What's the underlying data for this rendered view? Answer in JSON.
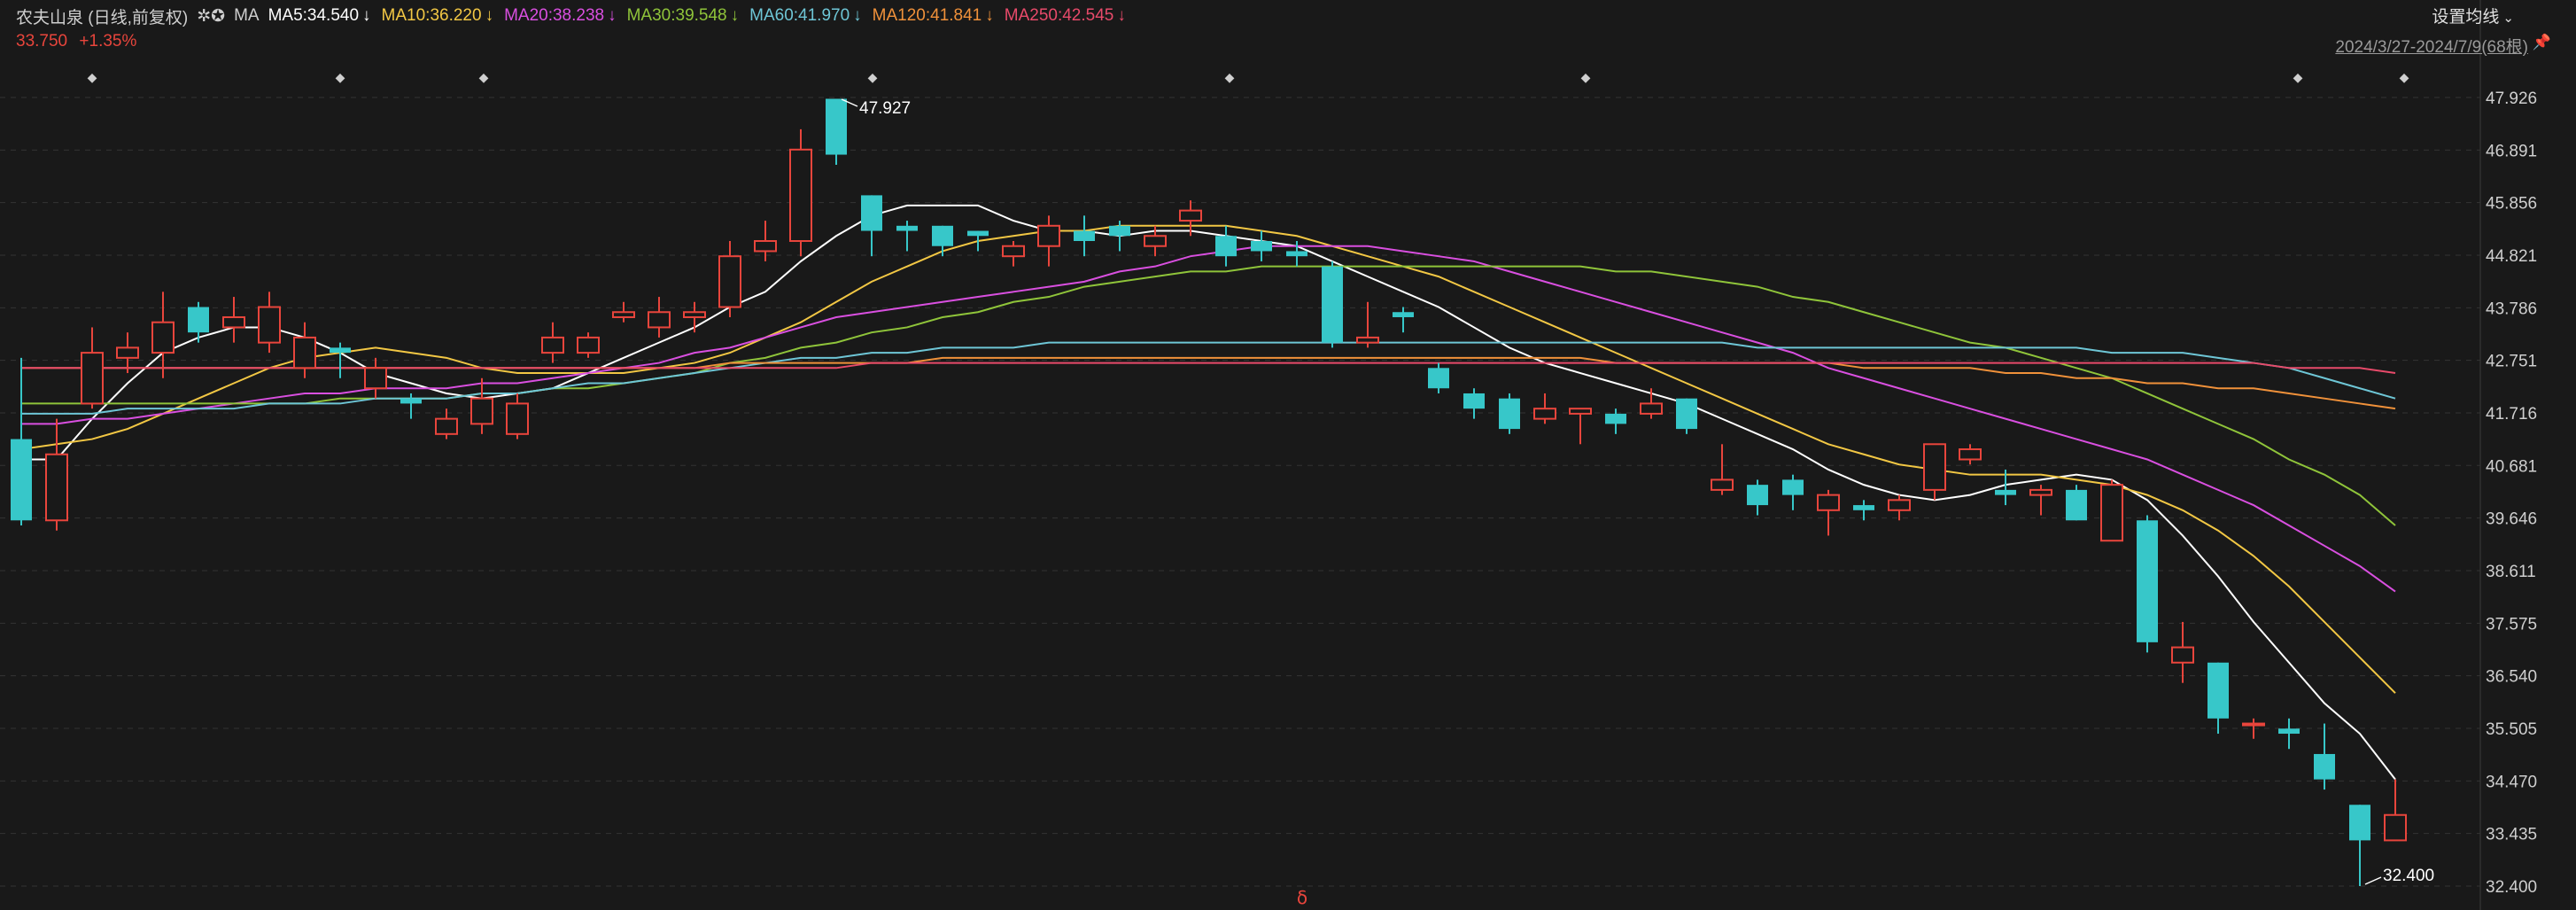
{
  "header": {
    "stock": "农夫山泉 (日线,前复权)",
    "ma_icon": "gear-close-icons",
    "ma_label": "MA",
    "ma_items": [
      {
        "text": "MA5:34.540",
        "color": "#ffffff"
      },
      {
        "text": "MA10:36.220",
        "color": "#f2c744"
      },
      {
        "text": "MA20:38.238",
        "color": "#d94fe0"
      },
      {
        "text": "MA30:39.548",
        "color": "#8fc43a"
      },
      {
        "text": "MA60:41.970",
        "color": "#6ec6d6"
      },
      {
        "text": "MA120:41.841",
        "color": "#f0913a"
      },
      {
        "text": "MA250:42.545",
        "color": "#e84a6a"
      }
    ],
    "arrow": "↓",
    "price": "33.750",
    "change": "+1.35%",
    "range": "2024/3/27-2024/7/9(68根)",
    "setting": "设置均线",
    "setting_chevron": "chevron-down-icon"
  },
  "chart_data": {
    "type": "candlestick",
    "y_ticks": [
      "47.926",
      "46.891",
      "45.856",
      "44.821",
      "43.786",
      "42.751",
      "41.716",
      "40.681",
      "39.646",
      "38.611",
      "37.575",
      "36.540",
      "35.505",
      "34.470",
      "33.435",
      "32.400"
    ],
    "ylim": [
      32.4,
      47.926
    ],
    "max_label": "47.927",
    "min_label": "32.400",
    "marker_text": "◆",
    "bottom_marker": "δ",
    "colors": {
      "up": "#e8453c",
      "down": "#37c7c9"
    },
    "candles": [
      [
        41.2,
        39.6,
        42.8,
        39.5
      ],
      [
        39.6,
        40.9,
        41.6,
        39.4
      ],
      [
        41.9,
        42.9,
        43.4,
        41.8
      ],
      [
        42.8,
        43.0,
        43.3,
        42.5
      ],
      [
        42.9,
        43.5,
        44.1,
        42.4
      ],
      [
        43.8,
        43.3,
        43.9,
        43.1
      ],
      [
        43.4,
        43.6,
        44.0,
        43.1
      ],
      [
        43.1,
        43.8,
        44.1,
        42.9
      ],
      [
        42.6,
        43.2,
        43.5,
        42.4
      ],
      [
        43.0,
        42.9,
        43.1,
        42.4
      ],
      [
        42.2,
        42.6,
        42.8,
        42.0
      ],
      [
        42.0,
        41.9,
        42.1,
        41.6
      ],
      [
        41.3,
        41.6,
        41.8,
        41.2
      ],
      [
        41.5,
        42.0,
        42.4,
        41.3
      ],
      [
        41.3,
        41.9,
        42.1,
        41.2
      ],
      [
        42.9,
        43.2,
        43.5,
        42.7
      ],
      [
        42.9,
        43.2,
        43.3,
        42.8
      ],
      [
        43.6,
        43.7,
        43.9,
        43.5
      ],
      [
        43.4,
        43.7,
        44.0,
        43.2
      ],
      [
        43.6,
        43.7,
        43.9,
        43.3
      ],
      [
        43.8,
        44.8,
        45.1,
        43.6
      ],
      [
        44.9,
        45.1,
        45.5,
        44.7
      ],
      [
        45.1,
        46.9,
        47.3,
        44.8
      ],
      [
        47.9,
        46.8,
        47.9,
        46.6
      ],
      [
        46.0,
        45.3,
        46.0,
        44.8
      ],
      [
        45.4,
        45.3,
        45.5,
        44.9
      ],
      [
        45.4,
        45.0,
        45.4,
        44.8
      ],
      [
        45.3,
        45.2,
        45.3,
        44.9
      ],
      [
        44.8,
        45.0,
        45.1,
        44.6
      ],
      [
        45.0,
        45.4,
        45.6,
        44.6
      ],
      [
        45.3,
        45.1,
        45.6,
        44.8
      ],
      [
        45.4,
        45.2,
        45.5,
        44.9
      ],
      [
        45.0,
        45.2,
        45.4,
        44.8
      ],
      [
        45.5,
        45.7,
        45.9,
        45.2
      ],
      [
        45.2,
        44.8,
        45.4,
        44.6
      ],
      [
        45.1,
        44.9,
        45.3,
        44.7
      ],
      [
        44.9,
        44.8,
        45.1,
        44.6
      ],
      [
        44.6,
        43.1,
        44.7,
        43.0
      ],
      [
        43.1,
        43.2,
        43.9,
        43.0
      ],
      [
        43.7,
        43.6,
        43.8,
        43.3
      ],
      [
        42.6,
        42.2,
        42.7,
        42.1
      ],
      [
        42.1,
        41.8,
        42.2,
        41.6
      ],
      [
        42.0,
        41.4,
        42.1,
        41.3
      ],
      [
        41.6,
        41.8,
        42.1,
        41.5
      ],
      [
        41.7,
        41.8,
        41.8,
        41.1
      ],
      [
        41.7,
        41.5,
        41.8,
        41.3
      ],
      [
        41.7,
        41.9,
        42.2,
        41.6
      ],
      [
        42.0,
        41.4,
        42.0,
        41.3
      ],
      [
        40.2,
        40.4,
        41.1,
        40.1
      ],
      [
        40.3,
        39.9,
        40.4,
        39.7
      ],
      [
        40.4,
        40.1,
        40.5,
        39.8
      ],
      [
        39.8,
        40.1,
        40.2,
        39.3
      ],
      [
        39.9,
        39.8,
        40.0,
        39.6
      ],
      [
        39.8,
        40.0,
        40.1,
        39.6
      ],
      [
        40.2,
        41.1,
        41.1,
        40.0
      ],
      [
        40.8,
        41.0,
        41.1,
        40.7
      ],
      [
        40.2,
        40.1,
        40.6,
        39.9
      ],
      [
        40.1,
        40.2,
        40.3,
        39.7
      ],
      [
        40.2,
        39.6,
        40.3,
        39.6
      ],
      [
        39.2,
        40.3,
        40.4,
        39.2
      ],
      [
        39.6,
        37.2,
        39.7,
        37.0
      ],
      [
        36.8,
        37.1,
        37.6,
        36.4
      ],
      [
        36.8,
        35.7,
        36.8,
        35.4
      ],
      [
        35.6,
        35.6,
        35.7,
        35.3
      ],
      [
        35.5,
        35.4,
        35.7,
        35.1
      ],
      [
        35.0,
        34.5,
        35.6,
        34.3
      ],
      [
        34.0,
        33.3,
        34.0,
        32.4
      ],
      [
        33.3,
        33.8,
        34.5,
        33.3
      ]
    ],
    "ma_lines": [
      {
        "name": "MA5",
        "color": "#ffffff",
        "values": [
          40.8,
          40.8,
          41.6,
          42.3,
          42.9,
          43.2,
          43.4,
          43.4,
          43.2,
          42.9,
          42.5,
          42.3,
          42.1,
          42.0,
          42.1,
          42.2,
          42.5,
          42.8,
          43.1,
          43.4,
          43.8,
          44.1,
          44.7,
          45.2,
          45.6,
          45.8,
          45.8,
          45.8,
          45.5,
          45.3,
          45.3,
          45.2,
          45.3,
          45.3,
          45.2,
          45.1,
          45.0,
          44.7,
          44.4,
          44.1,
          43.8,
          43.4,
          43.0,
          42.7,
          42.5,
          42.3,
          42.1,
          41.9,
          41.6,
          41.3,
          41.0,
          40.6,
          40.3,
          40.1,
          40.0,
          40.1,
          40.3,
          40.4,
          40.5,
          40.4,
          40.0,
          39.3,
          38.5,
          37.6,
          36.8,
          36.0,
          35.4,
          34.5
        ]
      },
      {
        "name": "MA10",
        "color": "#f2c744",
        "values": [
          41.0,
          41.1,
          41.2,
          41.4,
          41.7,
          42.0,
          42.3,
          42.6,
          42.8,
          42.9,
          43.0,
          42.9,
          42.8,
          42.6,
          42.5,
          42.5,
          42.5,
          42.5,
          42.6,
          42.7,
          42.9,
          43.2,
          43.5,
          43.9,
          44.3,
          44.6,
          44.9,
          45.1,
          45.2,
          45.3,
          45.3,
          45.4,
          45.4,
          45.4,
          45.4,
          45.3,
          45.2,
          45.0,
          44.8,
          44.6,
          44.4,
          44.1,
          43.8,
          43.5,
          43.2,
          42.9,
          42.6,
          42.3,
          42.0,
          41.7,
          41.4,
          41.1,
          40.9,
          40.7,
          40.6,
          40.5,
          40.5,
          40.5,
          40.4,
          40.3,
          40.1,
          39.8,
          39.4,
          38.9,
          38.3,
          37.6,
          36.9,
          36.2
        ]
      },
      {
        "name": "MA20",
        "color": "#d94fe0",
        "values": [
          41.5,
          41.5,
          41.6,
          41.6,
          41.7,
          41.8,
          41.9,
          42.0,
          42.1,
          42.1,
          42.2,
          42.2,
          42.2,
          42.3,
          42.3,
          42.4,
          42.5,
          42.6,
          42.7,
          42.9,
          43.0,
          43.2,
          43.4,
          43.6,
          43.7,
          43.8,
          43.9,
          44.0,
          44.1,
          44.2,
          44.3,
          44.5,
          44.6,
          44.8,
          44.9,
          45.0,
          45.0,
          45.0,
          45.0,
          44.9,
          44.8,
          44.7,
          44.5,
          44.3,
          44.1,
          43.9,
          43.7,
          43.5,
          43.3,
          43.1,
          42.9,
          42.6,
          42.4,
          42.2,
          42.0,
          41.8,
          41.6,
          41.4,
          41.2,
          41.0,
          40.8,
          40.5,
          40.2,
          39.9,
          39.5,
          39.1,
          38.7,
          38.2
        ]
      },
      {
        "name": "MA30",
        "color": "#8fc43a",
        "values": [
          41.9,
          41.9,
          41.9,
          41.9,
          41.9,
          41.9,
          41.9,
          41.9,
          41.9,
          42.0,
          42.0,
          42.0,
          42.0,
          42.1,
          42.1,
          42.2,
          42.2,
          42.3,
          42.4,
          42.5,
          42.7,
          42.8,
          43.0,
          43.1,
          43.3,
          43.4,
          43.6,
          43.7,
          43.9,
          44.0,
          44.2,
          44.3,
          44.4,
          44.5,
          44.5,
          44.6,
          44.6,
          44.6,
          44.6,
          44.6,
          44.6,
          44.6,
          44.6,
          44.6,
          44.6,
          44.5,
          44.5,
          44.4,
          44.3,
          44.2,
          44.0,
          43.9,
          43.7,
          43.5,
          43.3,
          43.1,
          43.0,
          42.8,
          42.6,
          42.4,
          42.1,
          41.8,
          41.5,
          41.2,
          40.8,
          40.5,
          40.1,
          39.5
        ]
      },
      {
        "name": "MA60",
        "color": "#6ec6d6",
        "values": [
          41.7,
          41.7,
          41.7,
          41.8,
          41.8,
          41.8,
          41.8,
          41.9,
          41.9,
          41.9,
          42.0,
          42.0,
          42.0,
          42.1,
          42.1,
          42.2,
          42.3,
          42.3,
          42.4,
          42.5,
          42.6,
          42.7,
          42.8,
          42.8,
          42.9,
          42.9,
          43.0,
          43.0,
          43.0,
          43.1,
          43.1,
          43.1,
          43.1,
          43.1,
          43.1,
          43.1,
          43.1,
          43.1,
          43.1,
          43.1,
          43.1,
          43.1,
          43.1,
          43.1,
          43.1,
          43.1,
          43.1,
          43.1,
          43.1,
          43.0,
          43.0,
          43.0,
          43.0,
          43.0,
          43.0,
          43.0,
          43.0,
          43.0,
          43.0,
          42.9,
          42.9,
          42.9,
          42.8,
          42.7,
          42.6,
          42.4,
          42.2,
          42.0
        ]
      },
      {
        "name": "MA120",
        "color": "#f0913a",
        "values": [
          42.6,
          42.6,
          42.6,
          42.6,
          42.6,
          42.6,
          42.6,
          42.6,
          42.6,
          42.6,
          42.6,
          42.6,
          42.6,
          42.6,
          42.6,
          42.6,
          42.6,
          42.6,
          42.6,
          42.6,
          42.7,
          42.7,
          42.7,
          42.7,
          42.7,
          42.7,
          42.8,
          42.8,
          42.8,
          42.8,
          42.8,
          42.8,
          42.8,
          42.8,
          42.8,
          42.8,
          42.8,
          42.8,
          42.8,
          42.8,
          42.8,
          42.8,
          42.8,
          42.8,
          42.8,
          42.7,
          42.7,
          42.7,
          42.7,
          42.7,
          42.7,
          42.7,
          42.6,
          42.6,
          42.6,
          42.6,
          42.5,
          42.5,
          42.4,
          42.4,
          42.3,
          42.3,
          42.2,
          42.2,
          42.1,
          42.0,
          41.9,
          41.8
        ]
      },
      {
        "name": "MA250",
        "color": "#e84a6a",
        "values": [
          42.6,
          42.6,
          42.6,
          42.6,
          42.6,
          42.6,
          42.6,
          42.6,
          42.6,
          42.6,
          42.6,
          42.6,
          42.6,
          42.6,
          42.6,
          42.6,
          42.6,
          42.6,
          42.6,
          42.6,
          42.6,
          42.6,
          42.6,
          42.6,
          42.7,
          42.7,
          42.7,
          42.7,
          42.7,
          42.7,
          42.7,
          42.7,
          42.7,
          42.7,
          42.7,
          42.7,
          42.7,
          42.7,
          42.7,
          42.7,
          42.7,
          42.7,
          42.7,
          42.7,
          42.7,
          42.7,
          42.7,
          42.7,
          42.7,
          42.7,
          42.7,
          42.7,
          42.7,
          42.7,
          42.7,
          42.7,
          42.7,
          42.7,
          42.7,
          42.7,
          42.7,
          42.7,
          42.7,
          42.7,
          42.6,
          42.6,
          42.6,
          42.5
        ]
      }
    ]
  }
}
